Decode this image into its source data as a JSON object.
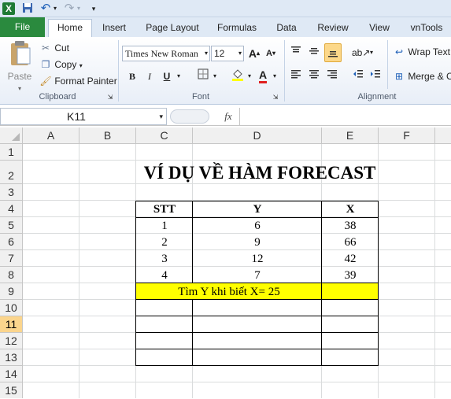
{
  "qat": {
    "excel_icon": "X",
    "save_icon": "save-icon",
    "undo_icon": "↶",
    "redo_icon": "↷"
  },
  "tabs": [
    "File",
    "Home",
    "Insert",
    "Page Layout",
    "Formulas",
    "Data",
    "Review",
    "View",
    "vnTools"
  ],
  "clipboard": {
    "paste": "Paste",
    "cut": "Cut",
    "copy": "Copy",
    "format_painter": "Format Painter",
    "label": "Clipboard"
  },
  "font": {
    "name": "Times New Roman",
    "size": "12",
    "bold": "B",
    "italic": "I",
    "underline": "U",
    "label": "Font"
  },
  "alignment": {
    "wrap_text": "Wrap Text",
    "merge": "Merge & C",
    "label": "Alignment"
  },
  "formula_bar": {
    "name_box": "K11",
    "fx": "fx",
    "value": ""
  },
  "columns": [
    "A",
    "B",
    "C",
    "D",
    "E",
    "F"
  ],
  "rows": [
    "1",
    "2",
    "3",
    "4",
    "5",
    "6",
    "7",
    "8",
    "9",
    "10",
    "11",
    "12",
    "13",
    "14",
    "15"
  ],
  "sheet": {
    "title": "VÍ DỤ VỀ HÀM FORECAST",
    "headers": [
      "STT",
      "Y",
      "X"
    ],
    "data": [
      [
        "1",
        "6",
        "38"
      ],
      [
        "2",
        "9",
        "66"
      ],
      [
        "3",
        "12",
        "42"
      ],
      [
        "4",
        "7",
        "39"
      ]
    ],
    "find_text": "Tìm Y khi biết X= 25",
    "highlight_color": "#ffff00"
  }
}
